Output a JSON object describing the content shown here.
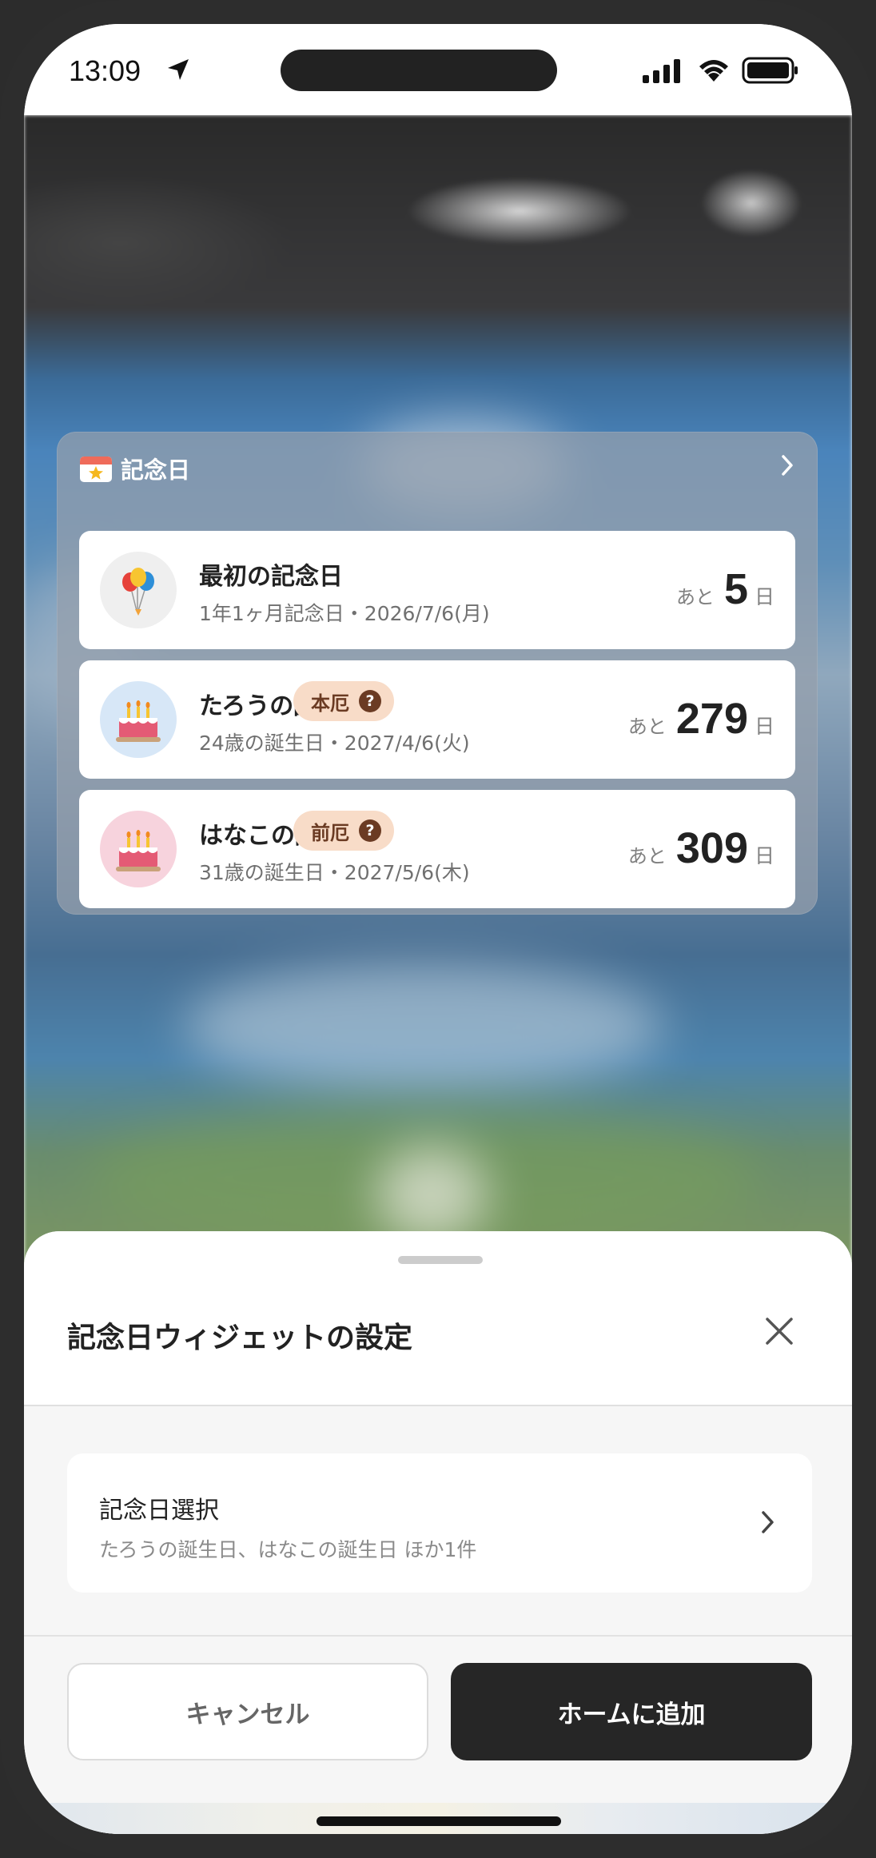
{
  "status_bar": {
    "time": "13:09",
    "icons": [
      "location-arrow-icon",
      "cellular-signal-icon",
      "wifi-icon",
      "battery-icon"
    ]
  },
  "widget": {
    "title": "記念日",
    "icon": "calendar-star-icon",
    "chevron_icon": "chevron-right-icon",
    "items": [
      {
        "name": "最初の記念日",
        "subtitle": "1年1ヶ月記念日・2026/7/6(月)",
        "badge": "",
        "count_prefix": "あと",
        "count": "5",
        "count_unit": "日",
        "avatar": "balloons-icon",
        "avatar_bg": "#efefef"
      },
      {
        "name": "たろうの誕生日",
        "subtitle": "24歳の誕生日・2027/4/6(火)",
        "badge": "本厄",
        "badge_icon": "question-circle-icon",
        "count_prefix": "あと",
        "count": "279",
        "count_unit": "日",
        "avatar": "birthday-cake-icon",
        "avatar_bg": "#d7e7f7"
      },
      {
        "name": "はなこの誕生日",
        "subtitle": "31歳の誕生日・2027/5/6(木)",
        "badge": "前厄",
        "badge_icon": "question-circle-icon",
        "count_prefix": "あと",
        "count": "309",
        "count_unit": "日",
        "avatar": "birthday-cake-icon",
        "avatar_bg": "#f7d3dd"
      }
    ]
  },
  "sheet": {
    "title": "記念日ウィジェットの設定",
    "close_icon": "close-icon",
    "setting": {
      "title": "記念日選択",
      "value": "たろうの誕生日、はなこの誕生日 ほか1件",
      "chevron_icon": "chevron-right-icon"
    },
    "cancel_label": "キャンセル",
    "add_label": "ホームに追加"
  },
  "colors": {
    "badge_bg": "#f8dcc8",
    "badge_text": "#6b3b23",
    "primary_button": "#262626",
    "frame": "#2d2d2d"
  }
}
